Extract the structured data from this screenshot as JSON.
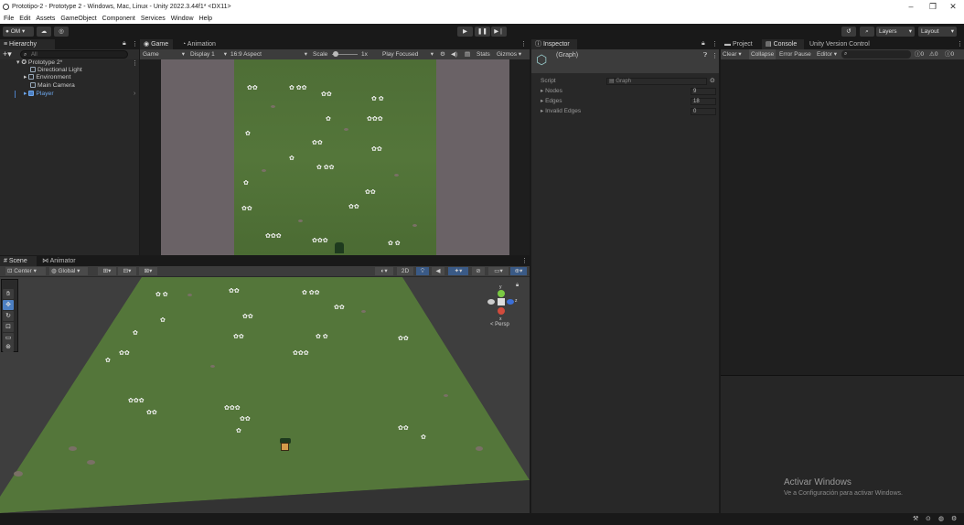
{
  "window": {
    "title": "Prototipo-2 - Prototype 2 - Windows, Mac, Linux - Unity 2022.3.44f1* <DX11>"
  },
  "menu": [
    "File",
    "Edit",
    "Assets",
    "GameObject",
    "Component",
    "Services",
    "Window",
    "Help"
  ],
  "toolbar": {
    "account": "OM",
    "layers": "Layers",
    "layout": "Layout"
  },
  "hierarchy": {
    "tab": "Hierarchy",
    "search_placeholder": "All",
    "scene": "Prototype 2*",
    "items": [
      {
        "label": "Directional Light"
      },
      {
        "label": "Environment"
      },
      {
        "label": "Main Camera"
      },
      {
        "label": "Player"
      }
    ]
  },
  "game": {
    "tabs": [
      "Game",
      "Animation"
    ],
    "mode": "Game",
    "display": "Display 1",
    "aspect": "16:9 Aspect",
    "scale_label": "Scale",
    "scale_value": "1x",
    "play_focused": "Play Focused",
    "stats": "Stats",
    "gizmos": "Gizmos"
  },
  "scene": {
    "tabs": [
      "Scene",
      "Animator"
    ],
    "pivot": "Center",
    "space": "Global",
    "mode2d": "2D",
    "gizmo_label": "Persp",
    "gizmo_axes": {
      "y": "y",
      "x": "x",
      "z": "z"
    }
  },
  "inspector": {
    "tab": "Inspector",
    "object": "(Graph)",
    "script_label": "Script",
    "script_value": "Graph",
    "fields": [
      {
        "label": "Nodes",
        "value": "9"
      },
      {
        "label": "Edges",
        "value": "18"
      },
      {
        "label": "Invalid Edges",
        "value": "0"
      }
    ]
  },
  "console": {
    "tabs": [
      "Project",
      "Console",
      "Unity Version Control"
    ],
    "buttons": [
      "Clear",
      "Collapse",
      "Error Pause",
      "Editor"
    ],
    "counts": [
      "0",
      "0",
      "0"
    ]
  },
  "watermark": {
    "title": "Activar Windows",
    "subtitle": "Ve a Configuración para activar Windows."
  },
  "colors": {
    "accent": "#4c7fc2",
    "panel": "#282828",
    "dark": "#191919",
    "grass": "#54763a",
    "play_active": "#3c5a8a"
  }
}
